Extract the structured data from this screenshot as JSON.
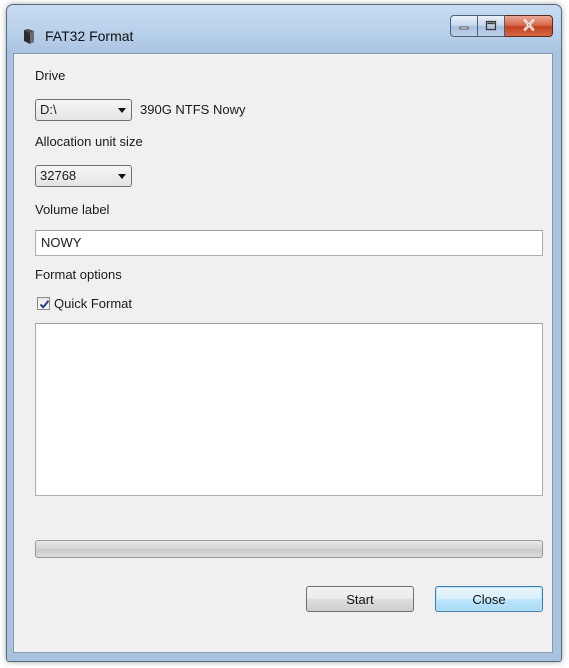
{
  "window": {
    "title": "FAT32 Format",
    "icon": "format-app-icon"
  },
  "drive": {
    "label": "Drive",
    "selected": "D:\\",
    "info": "390G NTFS Nowy"
  },
  "allocation": {
    "label": "Allocation unit size",
    "selected": "32768"
  },
  "volume": {
    "label": "Volume label",
    "value": "NOWY"
  },
  "options": {
    "label": "Format options",
    "quick_format_label": "Quick Format",
    "quick_format_checked": true
  },
  "log": {
    "text": ""
  },
  "progress": {
    "value_percent": 0
  },
  "buttons": {
    "start": "Start",
    "close": "Close"
  },
  "colors": {
    "title_bar": "#b6cfe9",
    "close_button": "#c2401d",
    "default_button_border": "#3c7fb1",
    "client_bg": "#f0f0f0"
  }
}
